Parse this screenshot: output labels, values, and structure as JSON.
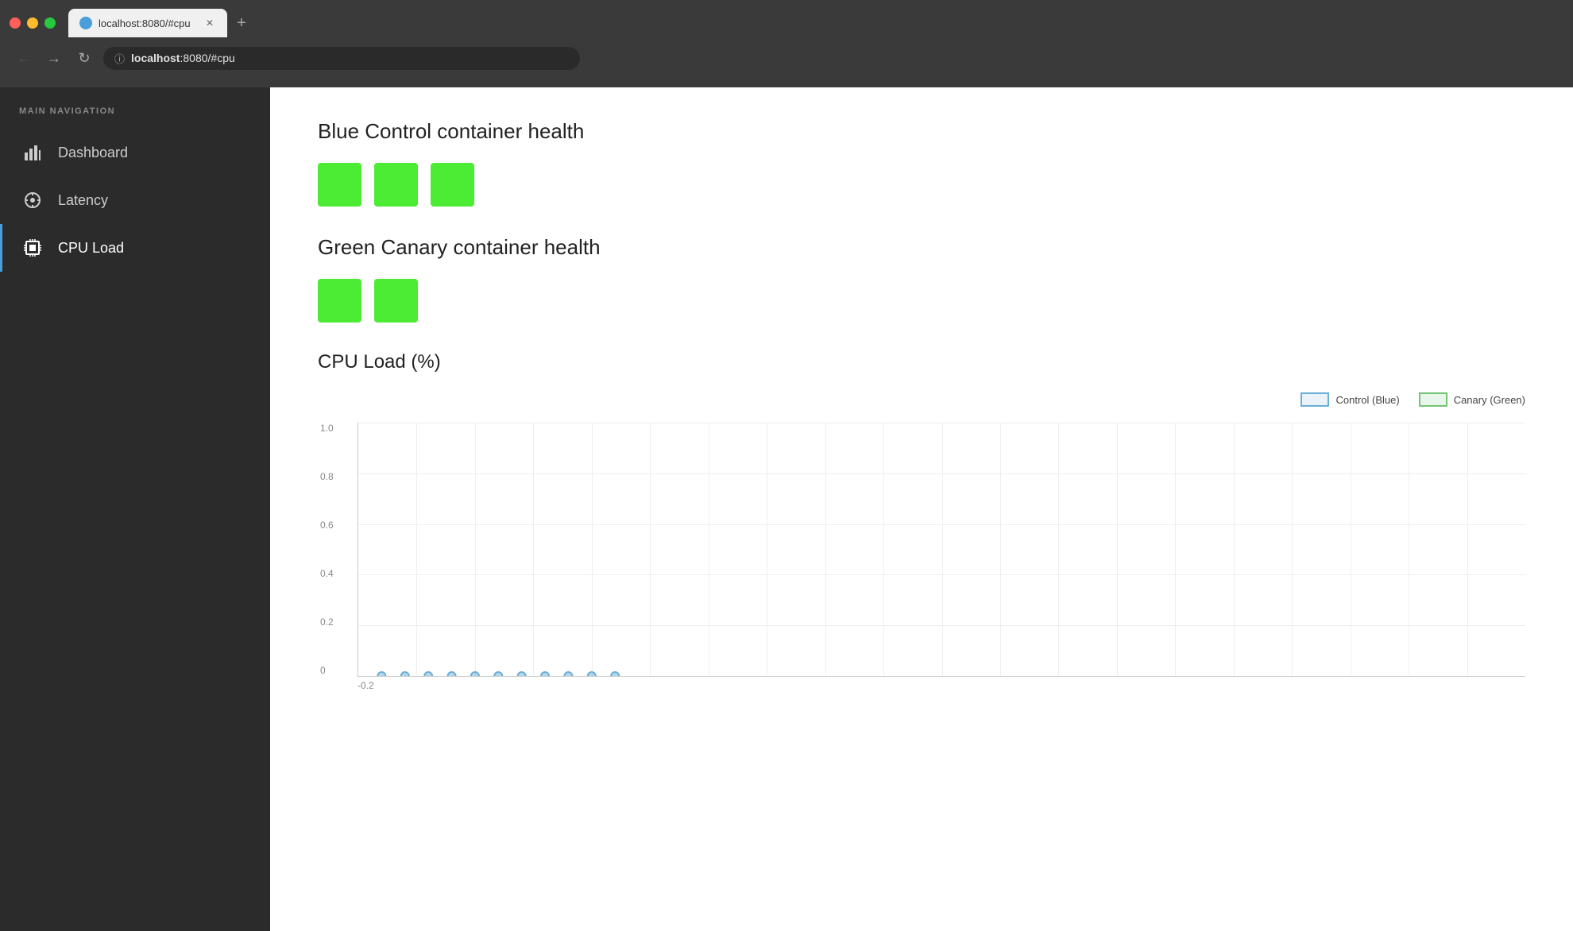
{
  "browser": {
    "tab_url": "localhost:8080/#cpu",
    "tab_title": "localhost:8080/#cpu",
    "address_bar": "localhost:8080/#cpu",
    "address_host": "localhost",
    "address_rest": ":8080/#cpu",
    "new_tab_label": "+"
  },
  "nav": {
    "label": "MAIN NAVIGATION",
    "items": [
      {
        "id": "dashboard",
        "label": "Dashboard",
        "active": false
      },
      {
        "id": "latency",
        "label": "Latency",
        "active": false
      },
      {
        "id": "cpu-load",
        "label": "CPU Load",
        "active": true
      }
    ]
  },
  "main": {
    "blue_title": "Blue Control container health",
    "blue_boxes": 3,
    "green_title": "Green Canary container health",
    "green_boxes": 2,
    "chart_title": "CPU Load (%)",
    "legend": {
      "blue_label": "Control (Blue)",
      "green_label": "Canary (Green)"
    },
    "y_axis": [
      "1.0",
      "0.8",
      "0.6",
      "0.4",
      "0.2",
      "0"
    ],
    "chart_dots_x_positions": [
      0,
      4,
      7,
      11,
      14,
      18,
      21,
      25,
      28,
      32,
      36
    ],
    "bottom_tick": "-0.2"
  }
}
